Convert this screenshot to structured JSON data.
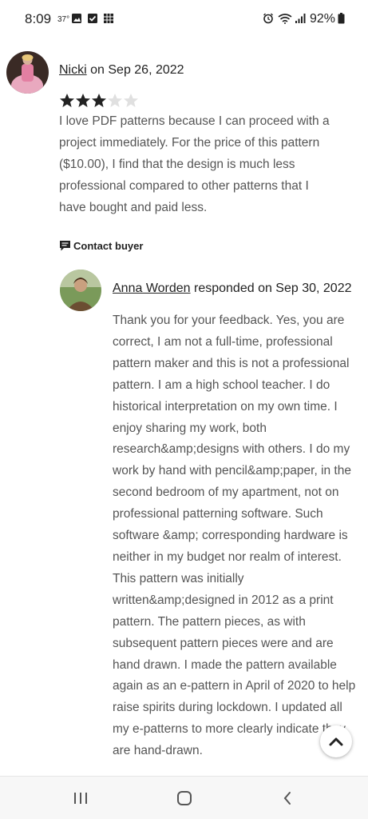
{
  "status_bar": {
    "time": "8:09",
    "temperature": "37°",
    "battery": "92%",
    "icons": [
      "image-icon",
      "checkbox-icon",
      "grid-icon",
      "alarm-icon",
      "wifi-icon",
      "signal-icon",
      "battery-icon"
    ]
  },
  "review": {
    "reviewer_name": "Nicki",
    "date_text": "on Sep 26, 2022",
    "rating": 3,
    "rating_max": 5,
    "text": "I love PDF patterns because I can proceed with a project immediately. For the price of this pattern ($10.00), I find that the design is much less professional compared to other patterns that I have bought and paid less.",
    "contact_label": "Contact buyer"
  },
  "response": {
    "seller_name": "Anna Worden",
    "responded_text": "responded on Sep 30, 2022",
    "text": "Thank you for your feedback. Yes, you are correct, I am not a full-time, professional pattern maker and this is not a professional pattern. I am a high school teacher. I do historical interpretation on my own time. I enjoy sharing my work, both research&amp;designs with others. I do my work by hand with pencil&amp;paper, in the second bedroom of my apartment, not on professional patterning software. Such software &amp; corresponding hardware is neither in my budget nor realm of interest. This pattern was initially written&amp;designed in 2012 as a print pattern. The pattern pieces, as with subsequent pattern pieces were and are hand drawn. I made the pattern available again as an e-pattern in April of 2020 to help raise spirits during lockdown. I updated all my e-patterns to more clearly indicate they are hand-drawn."
  },
  "colors": {
    "star_filled": "#222222",
    "star_empty": "#e0e0e0",
    "body_text": "#555555"
  },
  "navigation": {
    "icons": [
      "recent-apps-icon",
      "home-icon",
      "back-icon"
    ]
  }
}
